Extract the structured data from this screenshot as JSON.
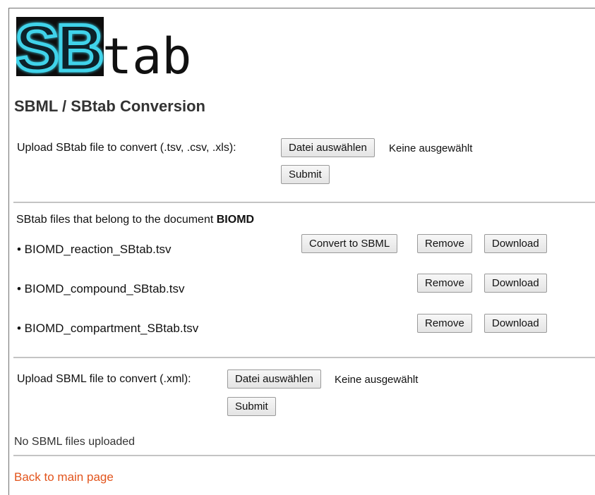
{
  "logo": {
    "text_sb": "SB",
    "text_tab": "tab"
  },
  "page_title": "SBML / SBtab Conversion",
  "sbtab_upload": {
    "label": "Upload SBtab file to convert (.tsv, .csv, .xls):",
    "choose_button": "Datei auswählen",
    "file_status": "Keine ausgewählt",
    "submit_button": "Submit"
  },
  "sbtab_files": {
    "intro": "SBtab files that belong to the document ",
    "document_name": "BIOMD",
    "files": [
      {
        "name": "• BIOMD_reaction_SBtab.tsv",
        "convert": "Convert to SBML",
        "remove": "Remove",
        "download": "Download"
      },
      {
        "name": "• BIOMD_compound_SBtab.tsv",
        "remove": "Remove",
        "download": "Download"
      },
      {
        "name": "• BIOMD_compartment_SBtab.tsv",
        "remove": "Remove",
        "download": "Download"
      }
    ]
  },
  "sbml_upload": {
    "label": "Upload SBML file to convert (.xml):",
    "choose_button": "Datei auswählen",
    "file_status": "Keine ausgewählt",
    "submit_button": "Submit"
  },
  "sbml_status": "No SBML files uploaded",
  "back_link": "Back to main page",
  "colors": {
    "link": "#e2541c",
    "logo_glow": "#3fd3ea",
    "rule": "#c4c4c4"
  }
}
